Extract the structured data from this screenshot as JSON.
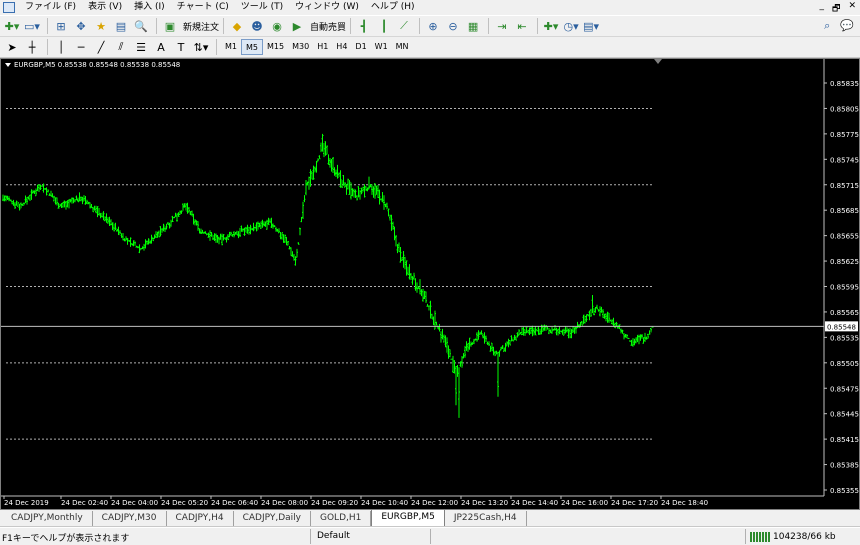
{
  "menu": {
    "items": [
      "ファイル (F)",
      "表示 (V)",
      "挿入 (I)",
      "チャート (C)",
      "ツール (T)",
      "ウィンドウ (W)",
      "ヘルプ (H)"
    ],
    "window_controls": [
      "_",
      "🗗",
      "✕"
    ]
  },
  "toolbar": {
    "new_order_label": "新規注文",
    "auto_trade_label": "自動売買"
  },
  "timeframes": {
    "items": [
      "M1",
      "M5",
      "M15",
      "M30",
      "H1",
      "H4",
      "D1",
      "W1",
      "MN"
    ],
    "active": "M5"
  },
  "chart": {
    "header": "EURGBP,M5  0.85538 0.85548 0.85538 0.85548",
    "current_price_label": "0.85548",
    "price_labels": [
      "0.85835",
      "0.85805",
      "0.85775",
      "0.85745",
      "0.85715",
      "0.85685",
      "0.85655",
      "0.85625",
      "0.85595",
      "0.85565",
      "0.85535",
      "0.85505",
      "0.85475",
      "0.85445",
      "0.85415",
      "0.85385",
      "0.85355"
    ],
    "time_labels": [
      "24 Dec 2019",
      "24 Dec 02:40",
      "24 Dec 04:00",
      "24 Dec 05:20",
      "24 Dec 06:40",
      "24 Dec 08:00",
      "24 Dec 09:20",
      "24 Dec 10:40",
      "24 Dec 12:00",
      "24 Dec 13:20",
      "24 Dec 14:40",
      "24 Dec 16:00",
      "24 Dec 17:20",
      "24 Dec 18:40"
    ],
    "colors": {
      "bar": "#00ff00",
      "background": "#000000",
      "grid": "#c0c0c0",
      "text": "#ffffff"
    }
  },
  "tabs": {
    "items": [
      "CADJPY,Monthly",
      "CADJPY,M30",
      "CADJPY,H4",
      "CADJPY,Daily",
      "GOLD,H1",
      "EURGBP,M5",
      "JP225Cash,H4"
    ],
    "active": "EURGBP,M5"
  },
  "status": {
    "help_text": "F1キーでヘルプが表示されます",
    "profile": "Default",
    "traffic": "104238/66 kb"
  }
}
